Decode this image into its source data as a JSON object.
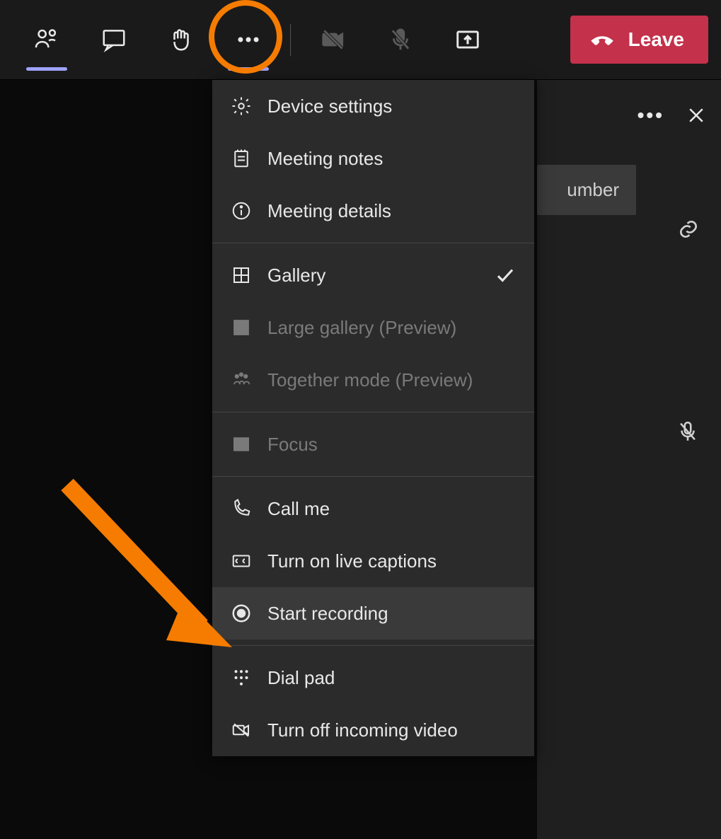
{
  "toolbar": {
    "leave_label": "Leave"
  },
  "panel": {
    "number_fragment": "umber"
  },
  "menu": {
    "device_settings": "Device settings",
    "meeting_notes": "Meeting notes",
    "meeting_details": "Meeting details",
    "gallery": "Gallery",
    "large_gallery": "Large gallery (Preview)",
    "together_mode": "Together mode (Preview)",
    "focus": "Focus",
    "call_me": "Call me",
    "turn_on_captions": "Turn on live captions",
    "start_recording": "Start recording",
    "dial_pad": "Dial pad",
    "turn_off_incoming_video": "Turn off incoming video"
  },
  "annotations": {
    "highlight_more_actions": true,
    "arrow_points_to": "start_recording"
  }
}
